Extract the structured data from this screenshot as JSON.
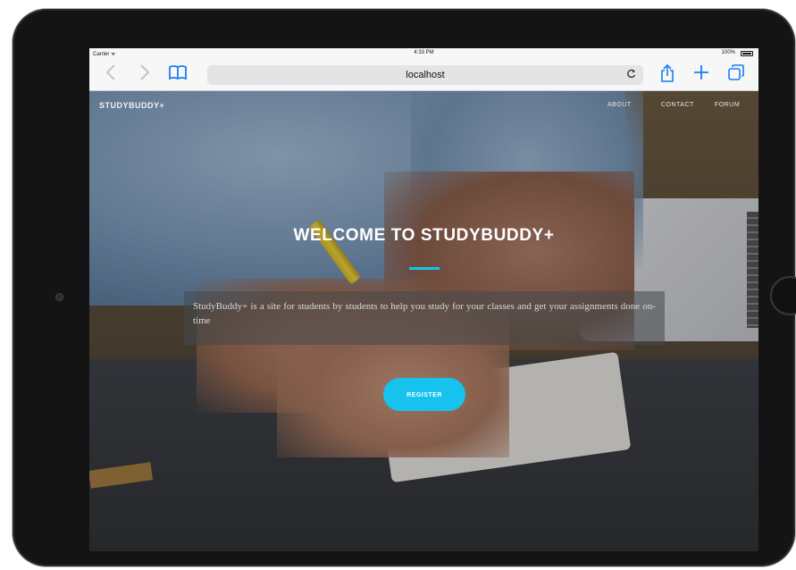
{
  "status_bar": {
    "carrier": "Carrier ᯤ",
    "time": "4:33 PM",
    "battery": "100%"
  },
  "browser": {
    "address": "localhost",
    "icons": [
      "back-icon",
      "forward-icon",
      "bookmarks-icon",
      "reload-icon",
      "share-icon",
      "plus-icon",
      "tabs-icon"
    ]
  },
  "site": {
    "brand": "STUDYBUDDY+",
    "nav": {
      "about": "ABOUT",
      "contact": "CONTACT",
      "forum": "FORUM"
    },
    "hero": {
      "title": "WELCOME TO STUDYBUDDY+",
      "description": "StudyBuddy+ is a site for students by students to help you study for your classes and get your assignments done on-time",
      "register_label": "REGISTER"
    }
  },
  "colors": {
    "accent": "#16c2ee",
    "browser_blue": "#1b7cf6"
  }
}
